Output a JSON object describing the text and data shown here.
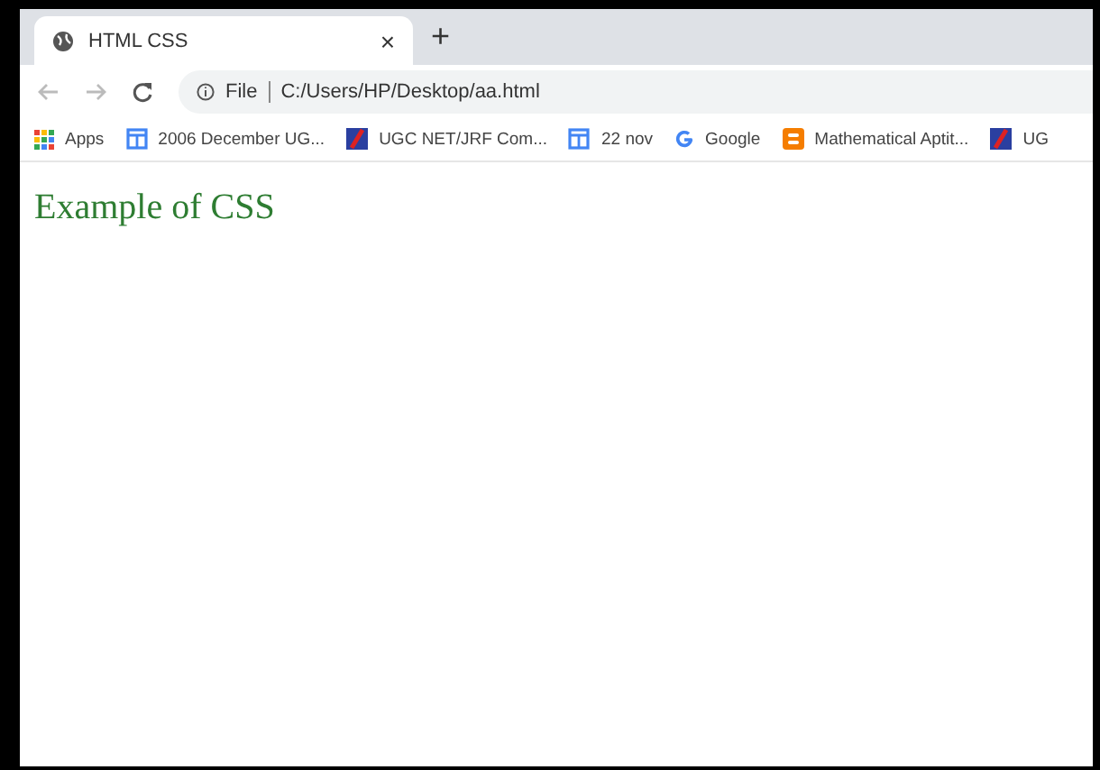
{
  "tabs": [
    {
      "title": "HTML CSS",
      "close": "×",
      "selected": true
    }
  ],
  "new_tab": "+",
  "address": {
    "scheme": "File",
    "url": "C:/Users/HP/Desktop/aa.html"
  },
  "bookmarks": [
    {
      "kind": "apps",
      "label": "Apps"
    },
    {
      "kind": "doc",
      "label": "2006 December UG..."
    },
    {
      "kind": "ugc",
      "label": "UGC NET/JRF Com..."
    },
    {
      "kind": "doc",
      "label": "22 nov"
    },
    {
      "kind": "google",
      "label": "Google"
    },
    {
      "kind": "blogger",
      "label": "Mathematical Aptit..."
    },
    {
      "kind": "ugc",
      "label": "UG"
    }
  ],
  "page": {
    "heading": "Example of CSS"
  }
}
